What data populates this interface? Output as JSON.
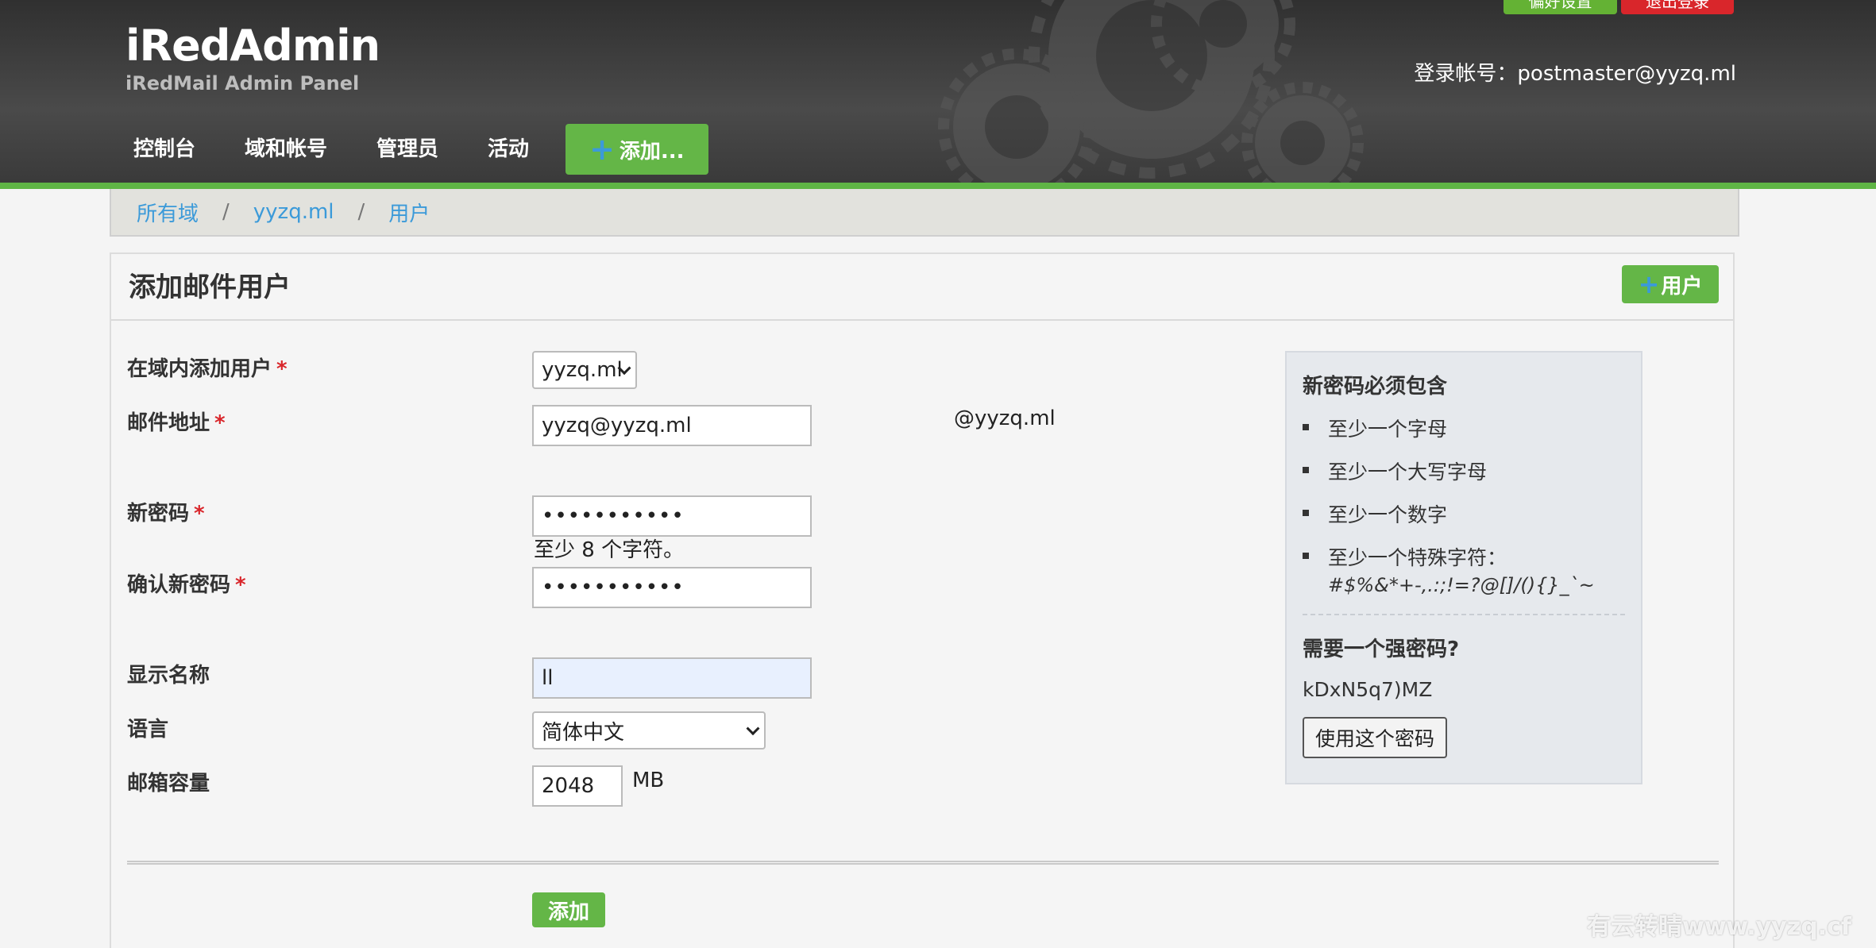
{
  "header": {
    "top_tabs": {
      "preferences": "偏好设置",
      "logout": "退出登录"
    },
    "brand_title": "iRedAdmin",
    "brand_subtitle": "iRedMail Admin Panel",
    "login_info": "登录帐号：postmaster@yyzq.ml",
    "nav": [
      "控制台",
      "域和帐号",
      "管理员",
      "活动"
    ],
    "nav_add": "添加..."
  },
  "breadcrumb": [
    "所有域",
    "yyzq.ml",
    "用户"
  ],
  "breadcrumb_sep": "/",
  "panel": {
    "title": "添加邮件用户",
    "user_button": "用户"
  },
  "form": {
    "domain_label": "在域内添加用户",
    "domain_value": "yyzq.ml",
    "email_label": "邮件地址",
    "email_value": "yyzq@yyzq.ml",
    "email_suffix": "@yyzq.ml",
    "password_label": "新密码",
    "password_value": "•••••••••••",
    "password_hint": "至少 8 个字符。",
    "confirm_label": "确认新密码",
    "confirm_value": "•••••••••••",
    "display_name_label": "显示名称",
    "display_name_value": "ll",
    "language_label": "语言",
    "language_value": "简体中文",
    "quota_label": "邮箱容量",
    "quota_value": "2048",
    "quota_unit": "MB",
    "required_mark": "*",
    "submit": "添加"
  },
  "sidebar": {
    "title": "新密码必须包含",
    "rules": [
      "至少一个字母",
      "至少一个大写字母",
      "至少一个数字",
      "至少一个特殊字符："
    ],
    "special_chars": "#$%&*+-,.:;!=?@[]/(){}_`~",
    "strong_title": "需要一个强密码?",
    "generated_password": "kDxN5q7)MZ",
    "use_button": "使用这个密码"
  },
  "watermark": "有云转晴www.yyzq.cf",
  "colors": {
    "accent_green": "#64b647",
    "link_blue": "#3b9ad9",
    "danger_red": "#d9262b"
  }
}
